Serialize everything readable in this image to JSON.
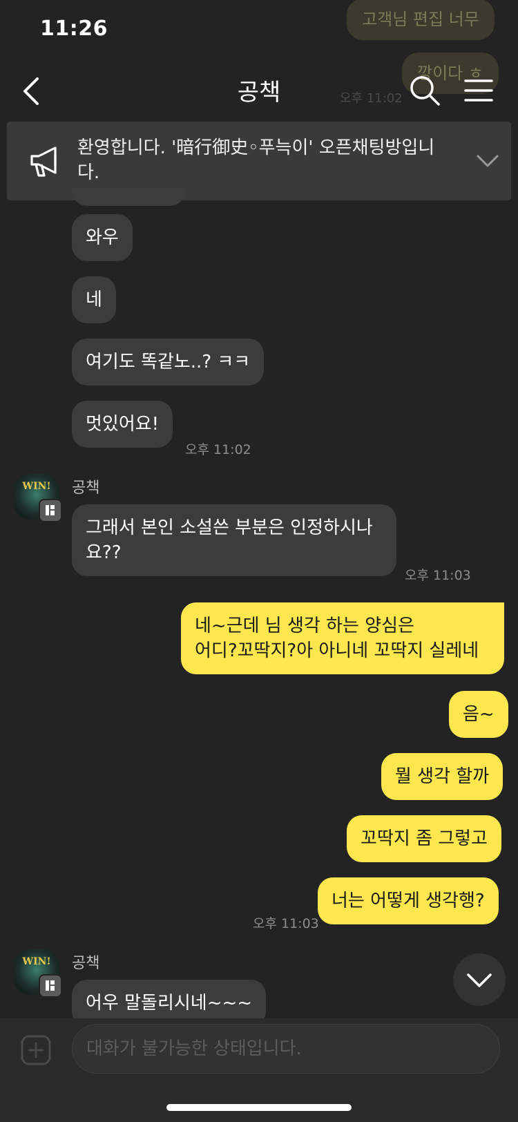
{
  "status_bar": {
    "time": "11:26"
  },
  "header": {
    "title": "공책"
  },
  "ghost_messages": [
    {
      "text": "고객님 편집 너무"
    },
    {
      "text": "깡이다 ㅎ"
    },
    {
      "time": "오후 11:02"
    }
  ],
  "notice": {
    "text": "환영합니다. '暗行御史◦푸늑이' 오픈채팅방입니다."
  },
  "messages": {
    "m1": "와우",
    "m2": "네",
    "m3": "여기도 똑같노..? ㅋㅋ",
    "m4": "멋있어요!",
    "m4_time": "오후 11:02",
    "sender1": "공책",
    "m5_line1": "그래서 본인 소설쓴 부분은 인정하시나",
    "m5_line2": "요??",
    "m5_time": "오후 11:03",
    "m6_line1": "네~근데 님 생각 하는 양심은",
    "m6_line2": "어디?꼬딱지?아 아니네 꼬딱지 실레네",
    "m7": "음~",
    "m8": "뭘 생각 할까",
    "m9": "꼬딱지 좀 그렇고",
    "m10": "너는 어떻게 생각행?",
    "m10_time": "오후 11:03",
    "sender2": "공책",
    "m11": "어우 말돌리시네~~~",
    "avatar_text": "WIN!"
  },
  "input": {
    "placeholder": "대화가 불가능한 상태입니다."
  },
  "colors": {
    "background": "#232323",
    "mine_bubble": "#fde74f",
    "other_bubble": "#3c3c3c"
  }
}
